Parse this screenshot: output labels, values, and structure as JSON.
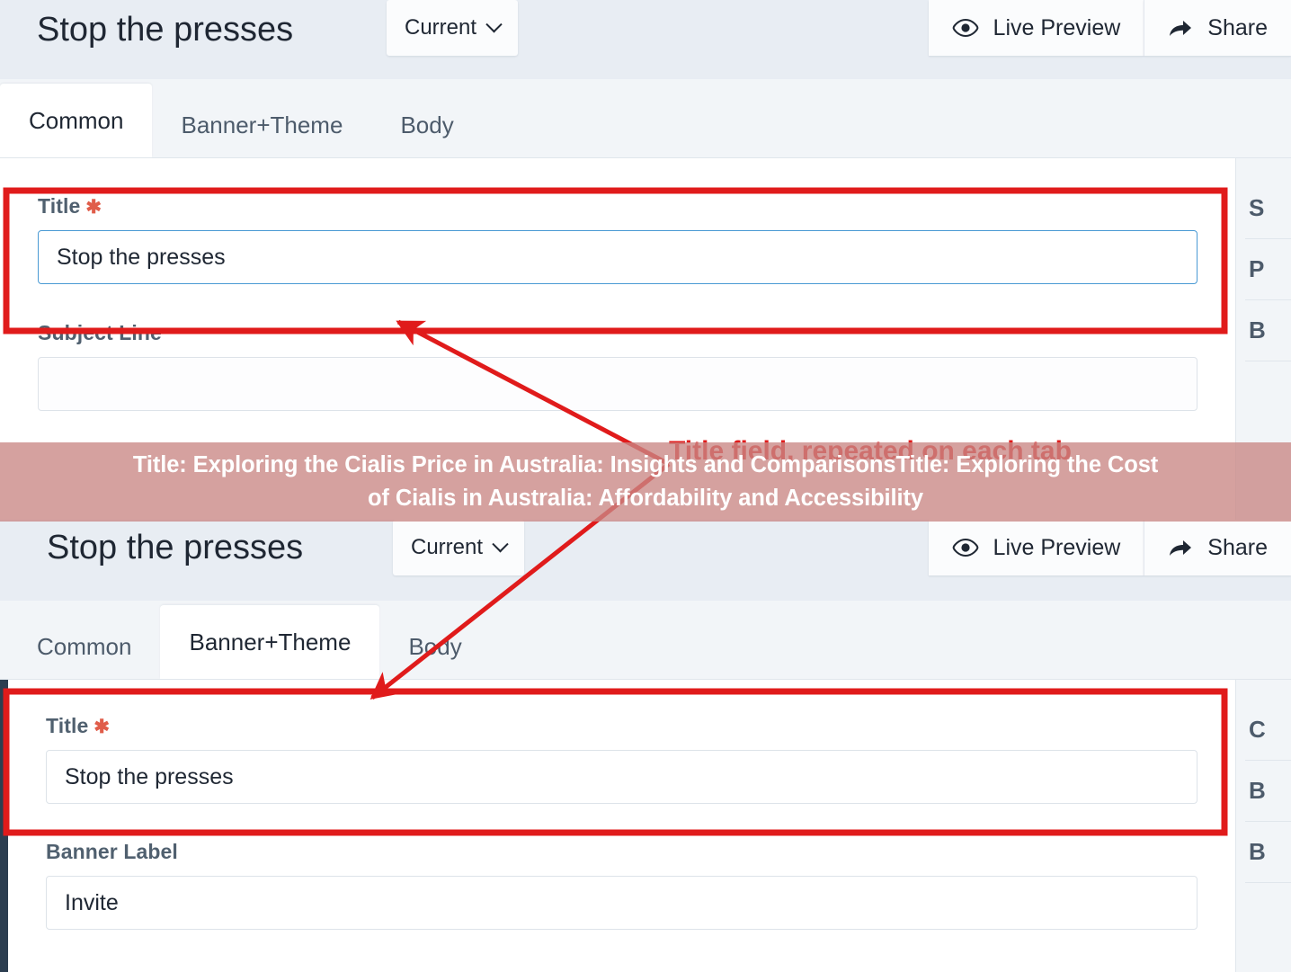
{
  "panels": [
    {
      "id": "panel-common",
      "header": {
        "title": "Stop the presses",
        "version_label": "Current",
        "chevron_icon": "chevron-down-icon",
        "actions": [
          {
            "label": "Live Preview",
            "icon": "eye-icon"
          },
          {
            "label": "Share",
            "icon": "share-arrow-icon"
          }
        ]
      },
      "tabs": [
        {
          "label": "Common",
          "active": true
        },
        {
          "label": "Banner+Theme",
          "active": false
        },
        {
          "label": "Body",
          "active": false
        }
      ],
      "fields": [
        {
          "label": "Title",
          "required": true,
          "value": "Stop the presses",
          "focused": true
        },
        {
          "label": "Subject Line",
          "required": false,
          "value": "",
          "focused": false
        }
      ],
      "sidebar": [
        "S",
        "P",
        "B"
      ]
    },
    {
      "id": "panel-banner-theme",
      "header": {
        "title": "Stop the presses",
        "version_label": "Current",
        "chevron_icon": "chevron-down-icon",
        "actions": [
          {
            "label": "Live Preview",
            "icon": "eye-icon"
          },
          {
            "label": "Share",
            "icon": "share-arrow-icon"
          }
        ]
      },
      "tabs": [
        {
          "label": "Common",
          "active": false
        },
        {
          "label": "Banner+Theme",
          "active": true
        },
        {
          "label": "Body",
          "active": false
        }
      ],
      "fields": [
        {
          "label": "Title",
          "required": true,
          "value": "Stop the presses",
          "focused": false
        },
        {
          "label": "Banner Label",
          "required": false,
          "value": "Invite",
          "focused": false
        }
      ],
      "sidebar": [
        "C",
        "B",
        "B"
      ]
    }
  ],
  "annotation": {
    "note": "Title field, repeated on each tab",
    "color": "#e01b1b"
  },
  "overlay_banner": {
    "line1": "Title: Exploring the Cialis Price in Australia: Insights and ComparisonsTitle: Exploring the Cost",
    "line2": "of Cialis in Australia: Affordability and Accessibility",
    "background": "#c98784",
    "text_color": "#ffffff"
  }
}
